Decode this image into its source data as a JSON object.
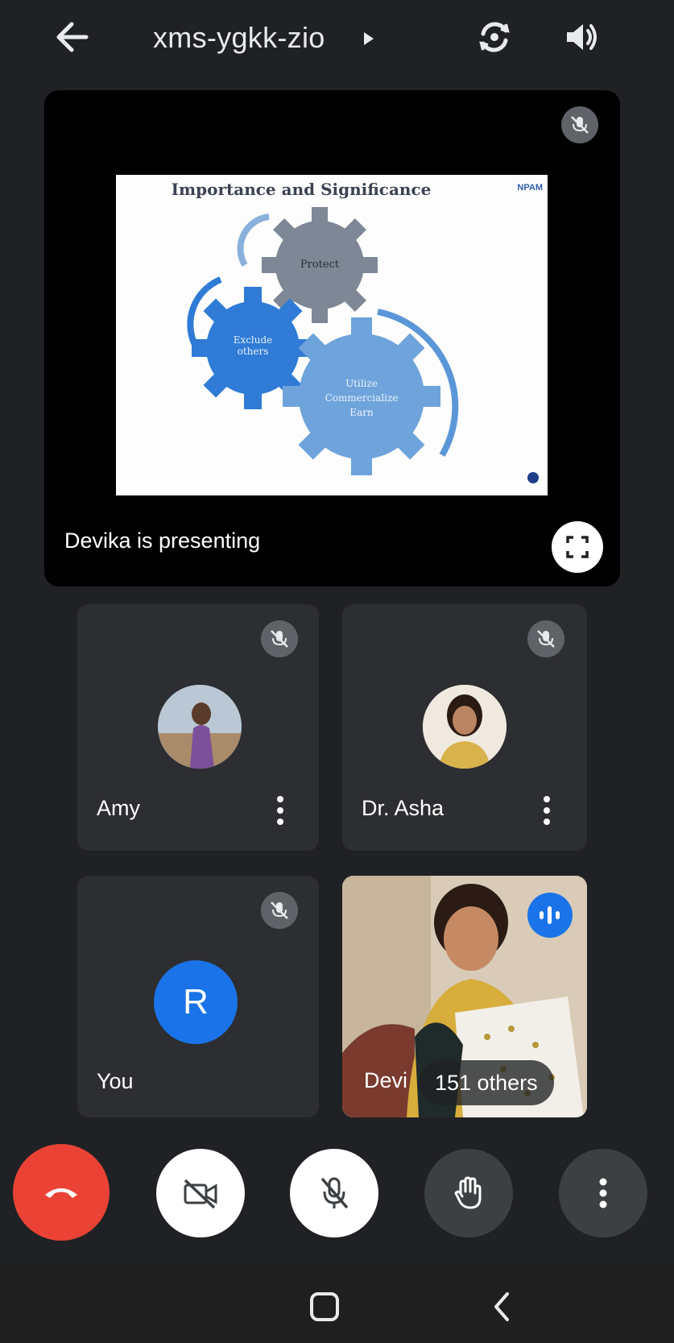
{
  "header": {
    "meeting_code": "xms-ygkk-zio",
    "back_icon": "arrow-left-icon",
    "switch_camera_icon": "switch-camera-icon",
    "audio_output_icon": "speaker-icon"
  },
  "presentation": {
    "label": "Devika is presenting",
    "slide": {
      "title": "Importance and Significance",
      "logo_text": "NPAM",
      "gears": [
        "Protect",
        "Exclude others",
        "Utilize Commercialize Earn"
      ]
    }
  },
  "participants": [
    {
      "name": "Amy",
      "muted": true
    },
    {
      "name": "Dr. Asha",
      "muted": true
    },
    {
      "name": "You",
      "initial": "R",
      "muted": true
    }
  ],
  "active_speaker": {
    "name_partial": "Devi",
    "others_label": "151 others"
  },
  "controls": [
    "end-call",
    "camera-off",
    "mic-off",
    "raise-hand",
    "more-options"
  ],
  "colors": {
    "background": "#202124",
    "tile": "#2d2e31",
    "end_call": "#ea4335",
    "accent": "#1a73e8"
  }
}
